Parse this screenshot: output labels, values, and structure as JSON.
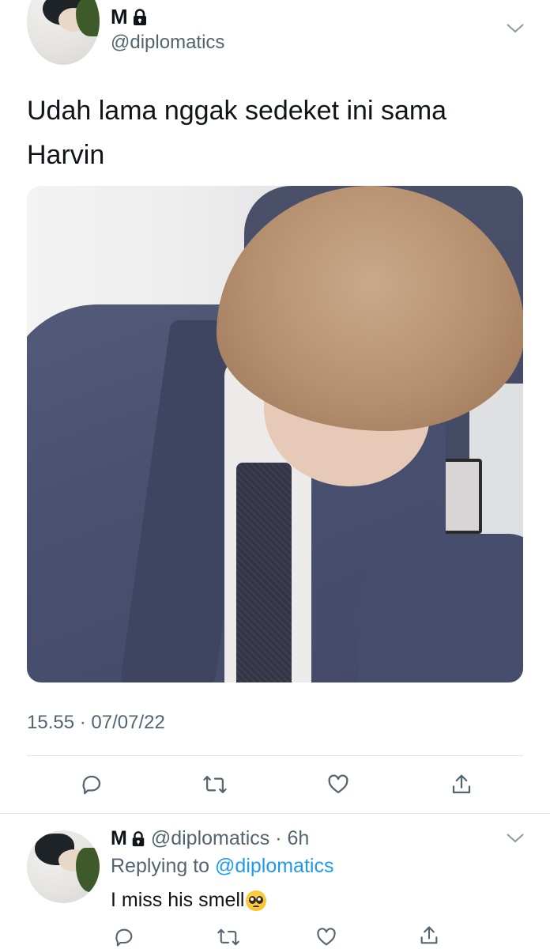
{
  "tweet": {
    "display_name": "M",
    "handle": "@diplomatics",
    "text_line1": "Udah lama nggak sedeket ini sama",
    "text_line2": "Harvin",
    "timestamp": "15.55 · 07/07/22"
  },
  "actions": [
    {
      "icon": "reply-icon"
    },
    {
      "icon": "retweet-icon"
    },
    {
      "icon": "like-icon"
    },
    {
      "icon": "share-icon"
    }
  ],
  "reply": {
    "display_name": "M",
    "handle_time": "@diplomatics · 6h",
    "replying_prefix": "Replying to",
    "replying_mention": "@diplomatics",
    "text": "I miss his smell",
    "emoji": "pleading-face-emoji"
  },
  "colors": {
    "text": "#0f1419",
    "secondary": "#536471",
    "link": "#1d9bf0",
    "divider": "#e3e6e9"
  }
}
